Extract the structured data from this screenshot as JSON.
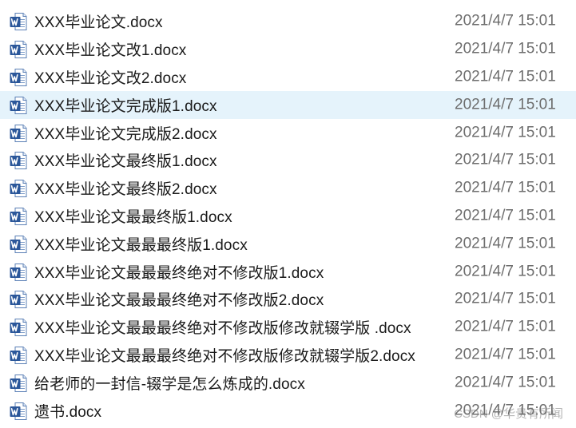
{
  "colors": {
    "selected_row": "#e5f3fb",
    "word_blue": "#2b579a",
    "name_text": "#1a1a1a",
    "date_text": "#6d6d6d"
  },
  "files": [
    {
      "name": "XXX毕业论文.docx",
      "date": "2021/4/7 15:01",
      "icon": "word-doc-icon"
    },
    {
      "name": "XXX毕业论文改1.docx",
      "date": "2021/4/7 15:01",
      "icon": "word-doc-icon"
    },
    {
      "name": "XXX毕业论文改2.docx",
      "date": "2021/4/7 15:01",
      "icon": "word-doc-icon"
    },
    {
      "name": "XXX毕业论文完成版1.docx",
      "date": "2021/4/7 15:01",
      "icon": "word-doc-icon",
      "selected": true
    },
    {
      "name": "XXX毕业论文完成版2.docx",
      "date": "2021/4/7 15:01",
      "icon": "word-doc-icon"
    },
    {
      "name": "XXX毕业论文最终版1.docx",
      "date": "2021/4/7 15:01",
      "icon": "word-doc-icon"
    },
    {
      "name": "XXX毕业论文最终版2.docx",
      "date": "2021/4/7 15:01",
      "icon": "word-doc-icon"
    },
    {
      "name": "XXX毕业论文最最终版1.docx",
      "date": "2021/4/7 15:01",
      "icon": "word-doc-icon"
    },
    {
      "name": "XXX毕业论文最最最终版1.docx",
      "date": "2021/4/7 15:01",
      "icon": "word-doc-icon"
    },
    {
      "name": "XXX毕业论文最最最终绝对不修改版1.docx",
      "date": "2021/4/7 15:01",
      "icon": "word-doc-icon"
    },
    {
      "name": "XXX毕业论文最最最终绝对不修改版2.docx",
      "date": "2021/4/7 15:01",
      "icon": "word-doc-icon"
    },
    {
      "name": "XXX毕业论文最最最终绝对不修改版修改就辍学版 .docx",
      "date": "2021/4/7 15:01",
      "icon": "word-doc-icon"
    },
    {
      "name": "XXX毕业论文最最最终绝对不修改版修改就辍学版2.docx",
      "date": "2021/4/7 15:01",
      "icon": "word-doc-icon"
    },
    {
      "name": "给老师的一封信-辍学是怎么炼成的.docx",
      "date": "2021/4/7 15:01",
      "icon": "word-doc-icon"
    },
    {
      "name": "遗书.docx",
      "date": "2021/4/7 15:01",
      "icon": "word-doc-icon"
    }
  ],
  "watermark": "CSDN @华贵有所闻"
}
